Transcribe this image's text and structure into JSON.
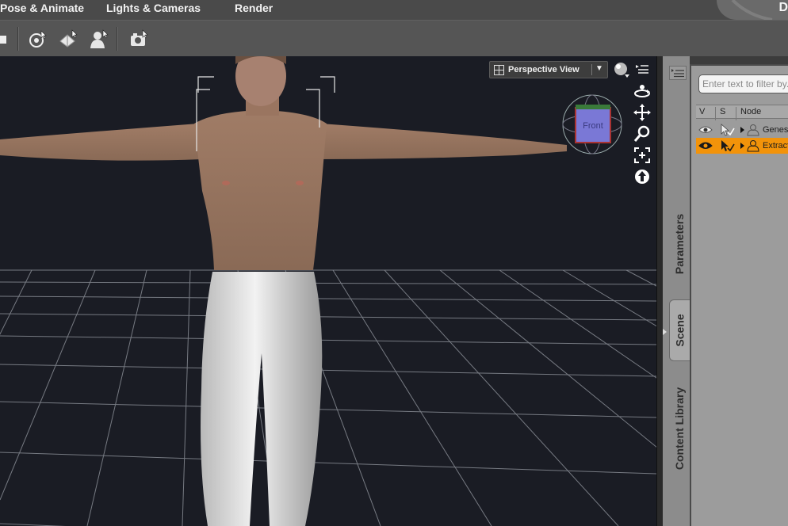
{
  "menu": {
    "tabs": [
      "Pose & Animate",
      "Lights & Cameras",
      "Render"
    ],
    "brand_letter": "D"
  },
  "toolbar": {
    "tools": [
      "universal-tool",
      "surface-selection-tool",
      "figure-tool",
      "spot-render-tool"
    ]
  },
  "viewport": {
    "view_label": "Perspective View",
    "cube_face": "Front",
    "controls": [
      "orbit-icon",
      "pan-icon",
      "zoom-icon",
      "frame-icon",
      "reset-icon"
    ]
  },
  "dock": {
    "tabs": [
      "Parameters",
      "Scene",
      "Content Library"
    ],
    "active_tab": "Scene"
  },
  "scene": {
    "filter_placeholder": "Enter text to filter by...",
    "columns": {
      "v": "V",
      "s": "S",
      "node": "Node"
    },
    "rows": [
      {
        "name": "Genesis",
        "selected": false
      },
      {
        "name": "Extracted",
        "selected": true
      }
    ]
  },
  "colors": {
    "viewport_bg": "#1a1c24",
    "selection_highlight": "#f2930a",
    "cube_face": "#7a78d6"
  }
}
